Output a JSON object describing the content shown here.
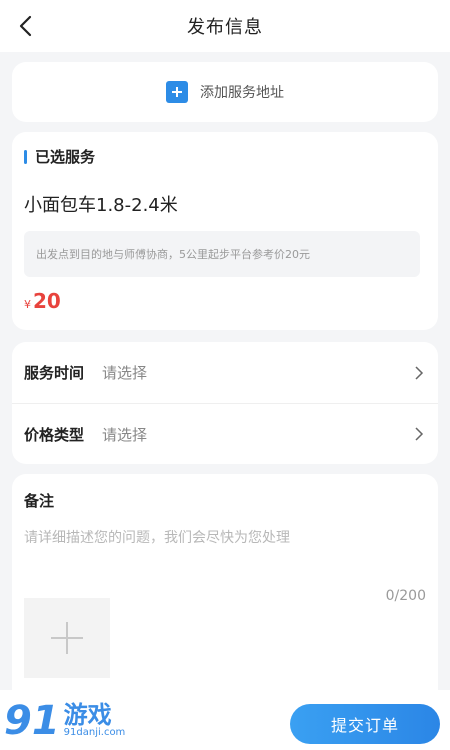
{
  "header": {
    "title": "发布信息",
    "back_icon": "chevron-left-icon"
  },
  "address": {
    "label": "添加服务地址",
    "icon": "plus-icon",
    "accent": "#2d8ce6"
  },
  "service": {
    "section_title": "已选服务",
    "name": "小面包车1.8-2.4米",
    "description": "出发点到目的地与师傅协商，5公里起步平台参考价20元",
    "price_symbol": "¥",
    "price": "20",
    "price_color": "#e8433d"
  },
  "selectors": [
    {
      "label": "服务时间",
      "value": "请选择"
    },
    {
      "label": "价格类型",
      "value": "请选择"
    }
  ],
  "notes": {
    "title": "备注",
    "placeholder": "请详细描述您的问题，我们会尽快为您处理",
    "counter": "0/200",
    "upload_icon": "plus-icon"
  },
  "footer": {
    "submit_label": "提交订单",
    "button_color": "#2b86e6"
  },
  "watermark": {
    "logo": "91",
    "name": "游戏",
    "url": "91danji.com"
  }
}
